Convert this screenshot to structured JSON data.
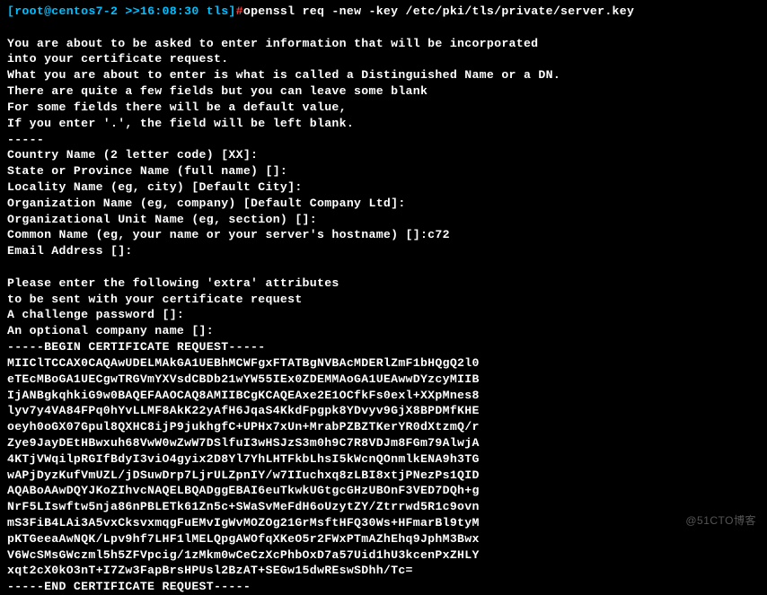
{
  "prompt": {
    "bracket_open": "[",
    "user_host": "root@centos7-2 >>16:08:30 tls",
    "bracket_close": "]",
    "symbol": "#",
    "command": "openssl req -new -key /etc/pki/tls/private/server.key"
  },
  "lines": [
    "",
    "You are about to be asked to enter information that will be incorporated",
    "into your certificate request.",
    "What you are about to enter is what is called a Distinguished Name or a DN.",
    "There are quite a few fields but you can leave some blank",
    "For some fields there will be a default value,",
    "If you enter '.', the field will be left blank.",
    "-----",
    "Country Name (2 letter code) [XX]:",
    "State or Province Name (full name) []:",
    "Locality Name (eg, city) [Default City]:",
    "Organization Name (eg, company) [Default Company Ltd]:",
    "Organizational Unit Name (eg, section) []:",
    "Common Name (eg, your name or your server's hostname) []:c72",
    "Email Address []:",
    "",
    "Please enter the following 'extra' attributes",
    "to be sent with your certificate request",
    "A challenge password []:",
    "An optional company name []:",
    "-----BEGIN CERTIFICATE REQUEST-----",
    "MIIClTCCAX0CAQAwUDELMAkGA1UEBhMCWFgxFTATBgNVBAcMDERlZmF1bHQgQ2l0",
    "eTEcMBoGA1UECgwTRGVmYXVsdCBDb21wYW55IEx0ZDEMMAoGA1UEAwwDYzcyMIIB",
    "IjANBgkqhkiG9w0BAQEFAAOCAQ8AMIIBCgKCAQEAxe2E1OCfkFs0exl+XXpMnes8",
    "lyv7y4VA84FPq0hYvLLMF8AkK22yAfH6JqaS4KkdFpgpk8YDvyv9GjX8BPDMfKHE",
    "oeyh0oGX07Gpul8QXHC8ijP9jukhgfC+UPHx7xUn+MrabPZBZTKerYR0dXtzmQ/r",
    "Zye9JayDEtHBwxuh68VwW0wZwW7DSlfuI3wHSJzS3m0h9C7R8VDJm8FGm79AlwjA",
    "4KTjVWqilpRGIfBdyI3viO4gyix2D8Yl7YhLHTFkbLhsI5kWcnQOnmlkENA9h3TG",
    "wAPjDyzKufVmUZL/jDSuwDrp7LjrULZpnIY/w7IIuchxq8zLBI8xtjPNezPs1QID",
    "AQABoAAwDQYJKoZIhvcNAQELBQADggEBAI6euTkwkUGtgcGHzUBOnF3VED7DQh+g",
    "NrF5LIswftw5nja86nPBLETk61Zn5c+SWaSvMeFdH6oUzytZY/Ztrrwd5R1c9ovn",
    "mS3FiB4LAi3A5vxCksvxmqgFuEMvIgWvMOZOg21GrMsftHFQ30Ws+HFmarBl9tyM",
    "pKTGeeaAwNQK/Lpv9hf7LHF1lMELQpgAWOfqXKeO5r2FWxPTmAZhEhq9JphM3Bwx",
    "V6WcSMsGWczml5h5ZFVpcig/1zMkm0wCeCzXcPhbOxD7a57Uid1hU3kcenPxZHLY",
    "xqt2cX0kO3nT+I7Zw3FapBrsHPUsl2BzAT+SEGw15dwREswSDhh/Tc=",
    "-----END CERTIFICATE REQUEST-----"
  ],
  "watermark": "@51CTO博客"
}
